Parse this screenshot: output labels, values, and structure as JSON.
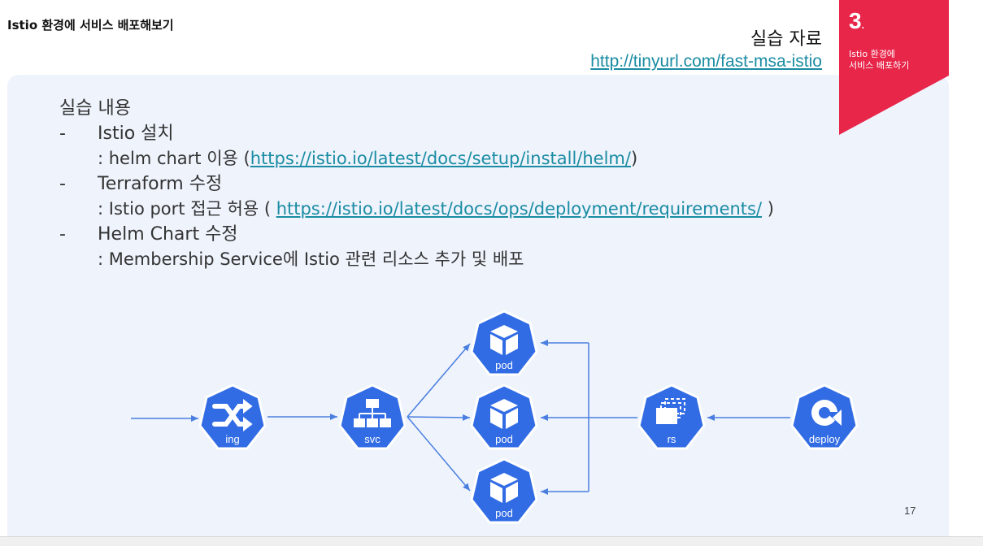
{
  "header": {
    "title": "Istio 환경에 서비스 배포해보기",
    "reference_label": "실습 자료",
    "reference_link": "http://tinyurl.com/fast-msa-istio"
  },
  "badge": {
    "number": "3",
    "dot": ".",
    "subtitle_line1": "Istio 환경에",
    "subtitle_line2": "서비스 배포하기",
    "color": "#e8264a"
  },
  "content": {
    "heading": "실습 내용",
    "items": [
      {
        "dash": "-",
        "title": "Istio 설치",
        "desc_prefix": ": helm chart 이용 (",
        "desc_link": "https://istio.io/latest/docs/setup/install/helm/",
        "desc_suffix": ")"
      },
      {
        "dash": "-",
        "title": "Terraform 수정",
        "desc_prefix": ": Istio port 접근 허용 ( ",
        "desc_link": "https://istio.io/latest/docs/ops/deployment/requirements/",
        "desc_suffix": " )"
      },
      {
        "dash": "-",
        "title": "Helm Chart 수정",
        "desc_prefix": ": Membership Service에 Istio 관련 리소스 추가 및 배포",
        "desc_link": "",
        "desc_suffix": ""
      }
    ]
  },
  "diagram": {
    "node_color": "#326ce5",
    "arrow_color": "#4a7fe0",
    "nodes": {
      "ing": "ing",
      "svc": "svc",
      "pod_top": "pod",
      "pod_mid": "pod",
      "pod_bottom": "pod",
      "rs": "rs",
      "deploy": "deploy"
    },
    "icons": {
      "ing": "shuffle-icon",
      "svc": "hierarchy-icon",
      "pod": "cube-icon",
      "rs": "stacked-pages-icon",
      "deploy": "rotate-icon"
    }
  },
  "footer": {
    "page_number": "17"
  }
}
